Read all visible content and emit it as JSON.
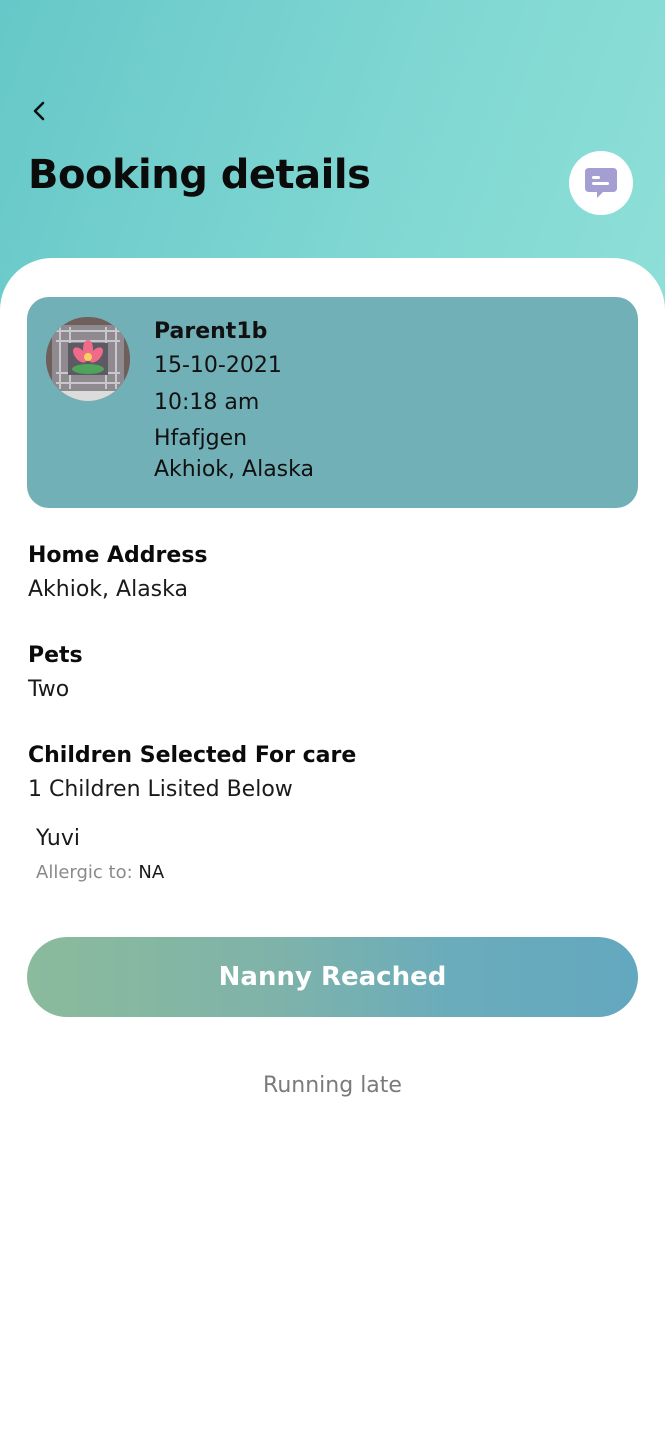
{
  "header": {
    "title": "Booking details"
  },
  "booking": {
    "parent_name": "Parent1b",
    "date": "15-10-2021",
    "time": "10:18 am",
    "address_line1": "Hfafjgen",
    "address_line2": "Akhiok, Alaska"
  },
  "home_address": {
    "label": "Home Address",
    "value": "Akhiok, Alaska"
  },
  "pets": {
    "label": "Pets",
    "value": "Two"
  },
  "children": {
    "label": "Children Selected For care",
    "summary": "1 Children Lisited Below",
    "items": [
      {
        "name": "Yuvi",
        "allergy_label": "Allergic to:",
        "allergy_value": "NA"
      }
    ]
  },
  "actions": {
    "primary_label": "Nanny Reached",
    "secondary_label": "Running late"
  },
  "colors": {
    "header_gradient_start": "#66c8c8",
    "header_gradient_end": "#8ee0d8",
    "card_bg": "#72b0b7",
    "button_gradient_start": "#8bbb9c",
    "button_gradient_end": "#64a8bf",
    "chat_icon": "#a59ed3"
  },
  "icons": {
    "back": "chevron-left-icon",
    "chat": "chat-bubble-icon"
  }
}
